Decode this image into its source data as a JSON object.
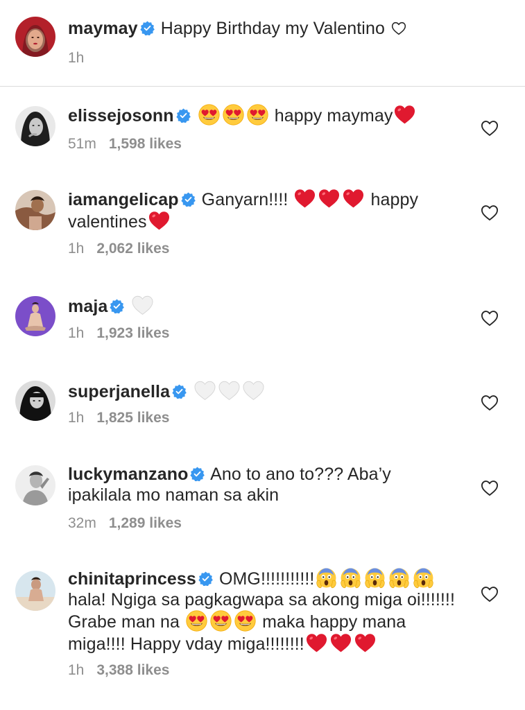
{
  "caption": {
    "username": "maymay",
    "text": "Happy Birthday my Valentino",
    "time": "1h",
    "trailing_icon": "white-heart-outline"
  },
  "comments": [
    {
      "username": "elissejosonn",
      "text_before": "",
      "emojis_before": [
        "heart-eyes",
        "heart-eyes",
        "heart-eyes"
      ],
      "text": "happy maymay",
      "emojis_after": [
        "red-heart"
      ],
      "time": "51m",
      "likes": "1,598 likes"
    },
    {
      "username": "iamangelicap",
      "text_before": "Ganyarn!!!!",
      "emojis_before": [
        "red-heart",
        "red-heart",
        "red-heart"
      ],
      "text": "happy valentines",
      "emojis_after": [
        "red-heart"
      ],
      "time": "1h",
      "likes": "2,062 likes"
    },
    {
      "username": "maja",
      "emojis": [
        "white-heart"
      ],
      "time": "1h",
      "likes": "1,923 likes"
    },
    {
      "username": "superjanella",
      "emojis": [
        "white-heart",
        "white-heart",
        "white-heart"
      ],
      "time": "1h",
      "likes": "1,825 likes"
    },
    {
      "username": "luckymanzano",
      "text": "Ano to ano to??? Aba’y ipakilala mo naman sa akin",
      "time": "32m",
      "likes": "1,289 likes"
    },
    {
      "username": "chinitaprincess",
      "text_a": "OMG!!!!!!!!!!!",
      "emojis_a": [
        "screaming-face",
        "screaming-face",
        "screaming-face",
        "screaming-face",
        "screaming-face"
      ],
      "text_b": "hala! Ngiga sa pagkagwapa sa akong miga oi!!!!!!! Grabe man na",
      "emojis_b": [
        "heart-eyes",
        "heart-eyes",
        "heart-eyes"
      ],
      "text_c": "maka happy mana miga!!!! Happy vday miga!!!!!!!!",
      "emojis_c": [
        "red-heart",
        "red-heart",
        "red-heart"
      ],
      "time": "1h",
      "likes": "3,388 likes"
    }
  ],
  "colors": {
    "verified": "#3897f0",
    "meta": "#8e8e8e",
    "divider": "#dbdbdb",
    "heart": "#e0245e"
  }
}
